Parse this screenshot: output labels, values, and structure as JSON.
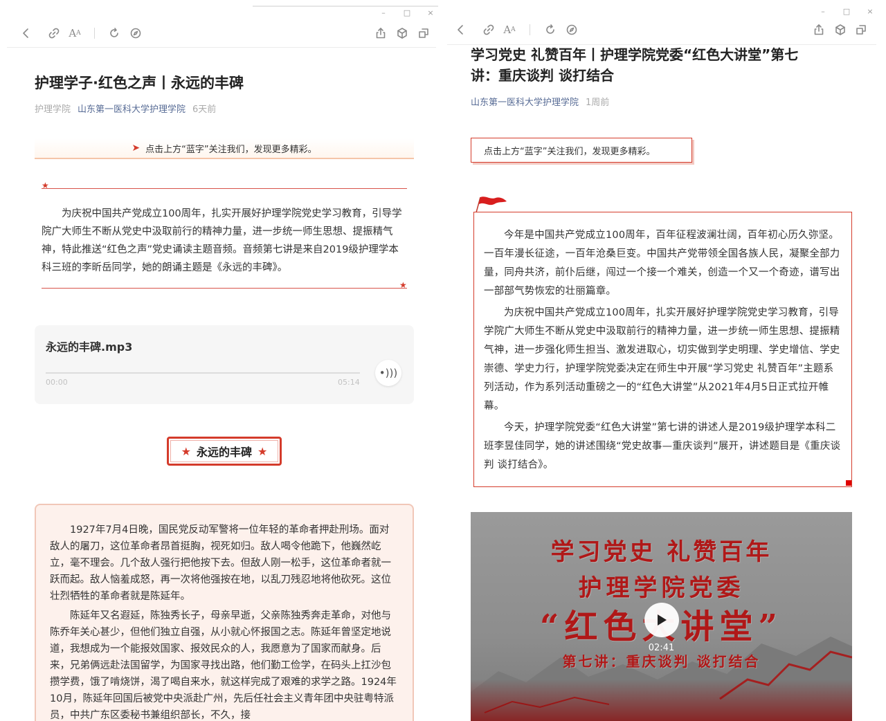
{
  "left": {
    "window_controls": [
      "–",
      "□",
      "×"
    ],
    "article": {
      "title": "护理学子·红色之声丨永远的丰碑",
      "source": "护理学院",
      "account": "山东第一医科大学护理学院",
      "time": "6天前"
    },
    "follow_banner": "点击上方“蓝字”关注我们，发现更多精彩。",
    "intro": "为庆祝中国共产党成立100周年，扎实开展好护理学院党史学习教育，引导学院广大师生不断从党史中汲取前行的精神力量，进一步统一师生思想、提振精气神，特此推送“红色之声”党史诵读主题音频。音频第七讲是来自2019级护理学本科三班的李昕岳同学，她的朗诵主题是《永远的丰碑》。",
    "audio": {
      "filename": "永远的丰碑.mp3",
      "current_time": "00:00",
      "duration": "05:14",
      "progress": 0
    },
    "poem_title": "永远的丰碑",
    "poem_paragraphs": [
      "1927年7月4日晚，国民党反动军警将一位年轻的革命者押赴刑场。面对敌人的屠刀，这位革命者昂首挺胸，视死如归。敌人喝令他跪下，他巍然屹立，毫不理会。几个敌人强行把他按下去。但敌人刚一松手，这位革命者就一跃而起。敌人恼羞成怒，再一次将他强按在地，以乱刀残忍地将他砍死。这位壮烈牺牲的革命者就是陈延年。",
      "陈延年又名遐延，陈独秀长子，母亲早逝，父亲陈独秀奔走革命，对他与陈乔年关心甚少，但他们独立自强，从小就心怀报国之志。陈延年曾坚定地说道，我想成为一个能报效国家、报效民众的人，我愿意为了国家而献身。后来，兄弟俩远赴法国留学，为国家寻找出路，他们勤工俭学，在码头上扛沙包攒学费，饿了啃烧饼，渴了喝自来水，就这样完成了艰难的求学之路。1924年10月，陈延年回国后被党中央派赴广州，先后任社会主义青年团中央驻粤特派员，中共广东区委秘书兼组织部长，不久，接"
    ]
  },
  "right": {
    "window_controls": [
      "–",
      "□",
      "×"
    ],
    "article": {
      "title_line1": "学习党史 礼赞百年丨护理学院党委“红色大讲堂”第七",
      "title_line2": "讲：重庆谈判 谈打结合",
      "account": "山东第一医科大学护理学院",
      "time": "1周前"
    },
    "follow_banner": "点击上方“蓝字”关注我们，发现更多精彩。",
    "paragraphs": [
      "今年是中国共产党成立100周年，百年征程波澜壮阔，百年初心历久弥坚。一百年漫长征途，一百年沧桑巨变。中国共产党带领全国各族人民，凝聚全部力量，同舟共济，前仆后继，闯过一个接一个难关，创造一个又一个奇迹，谱写出一部部气势恢宏的壮丽篇章。",
      "为庆祝中国共产党成立100周年，扎实开展好护理学院党史学习教育，引导学院广大师生不断从党史中汲取前行的精神力量，进一步统一师生思想、提振精气神，进一步强化师生担当、激发进取心，切实做到学史明理、学史增信、学史崇德、学史力行，护理学院党委决定在师生中开展“学习党史 礼赞百年”主题系列活动，作为系列活动重磅之一的“红色大讲堂”从2021年4月5日正式拉开帷幕。",
      "今天，护理学院党委“红色大讲堂”第七讲的讲述人是2019级护理学本科二班李昱佳同学，她的讲述围绕“党史故事—重庆谈判”展开，讲述题目是《重庆谈判 谈打结合》。"
    ],
    "video": {
      "poster_line1": "学习党史  礼赞百年",
      "poster_line2": "护理学院党委",
      "poster_line3": "“红色大讲堂”",
      "poster_line4": "第七讲：重庆谈判 谈打结合",
      "duration": "02:41"
    }
  },
  "icons": [
    "back-icon",
    "link-icon",
    "font-size-icon",
    "refresh-icon",
    "compass-icon",
    "share-icon",
    "cube-icon",
    "open-window-icon",
    "play-icon",
    "audio-wave-icon",
    "star-icon",
    "flag-icon"
  ],
  "colors": {
    "accent_red": "#d43b2b",
    "account_blue": "#576b95",
    "poem_bg": "#fdf1ec"
  }
}
